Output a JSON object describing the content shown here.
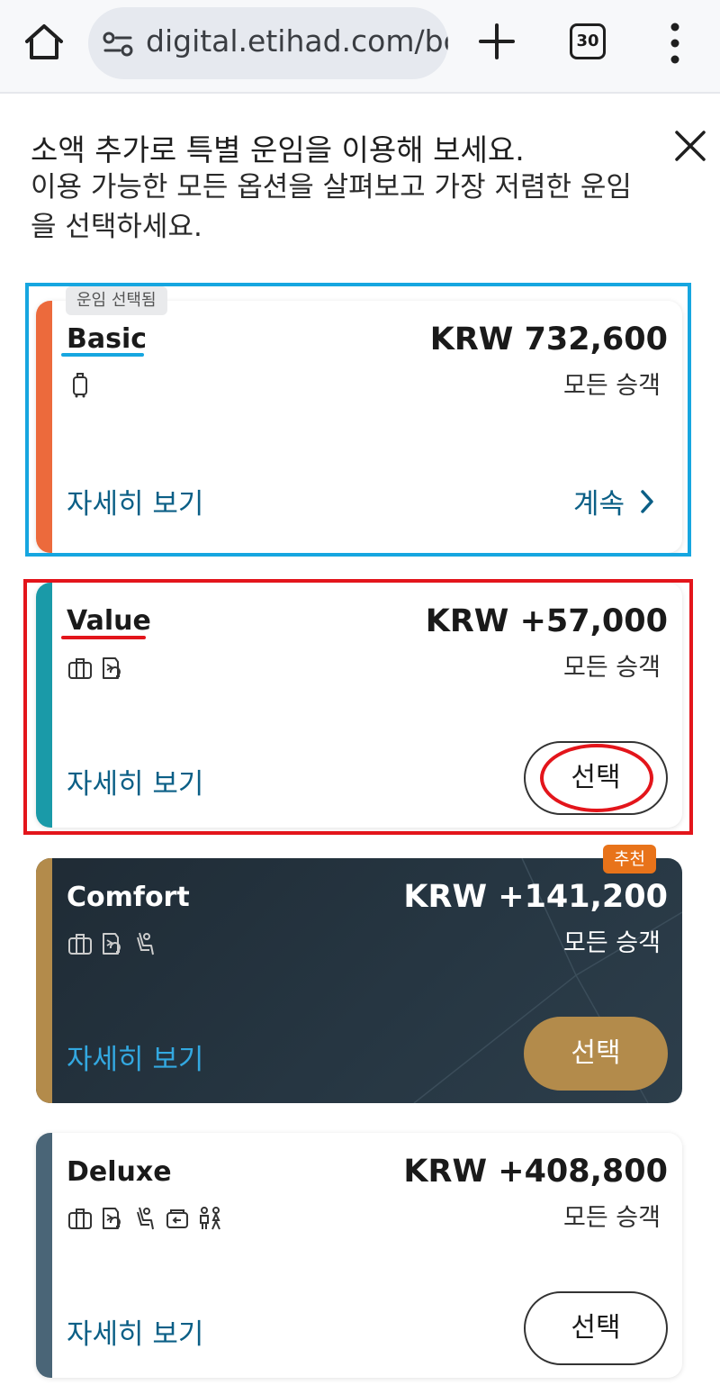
{
  "browser": {
    "url": "digital.etihad.com/boo",
    "tab_count": "30"
  },
  "header": {
    "headline": "소액 추가로 특별 운임을 이용해 보세요.",
    "subline": "이용 가능한 모든 옵션을 살펴보고 가장 저렴한 운임을 선택하세요."
  },
  "fares": [
    {
      "name": "Basic",
      "badge": "운임 선택됨",
      "price": "KRW 732,600",
      "passengers": "모든 승객",
      "details_label": "자세히 보기",
      "action_label": "계속",
      "stripe_color": "#ec6a3c",
      "icons": [
        "carry-on-bag-icon"
      ]
    },
    {
      "name": "Value",
      "price": "KRW +57,000",
      "passengers": "모든 승객",
      "details_label": "자세히 보기",
      "action_label": "선택",
      "stripe_color": "#1a9aa8",
      "icons": [
        "checked-bag-icon",
        "ticket-change-icon"
      ]
    },
    {
      "name": "Comfort",
      "badge": "추천",
      "price": "KRW +141,200",
      "passengers": "모든 승객",
      "details_label": "자세히 보기",
      "action_label": "선택",
      "stripe_color": "#b38b4b",
      "icons": [
        "checked-bag-icon",
        "ticket-change-icon",
        "seat-icon"
      ]
    },
    {
      "name": "Deluxe",
      "price": "KRW +408,800",
      "passengers": "모든 승객",
      "details_label": "자세히 보기",
      "action_label": "선택",
      "stripe_color": "#4a6577",
      "icons": [
        "checked-bag-icon",
        "ticket-change-icon",
        "seat-icon",
        "refund-icon",
        "lounge-icon"
      ]
    }
  ],
  "annotations": {
    "blue": "#16a6e0",
    "red": "#e3151b"
  }
}
